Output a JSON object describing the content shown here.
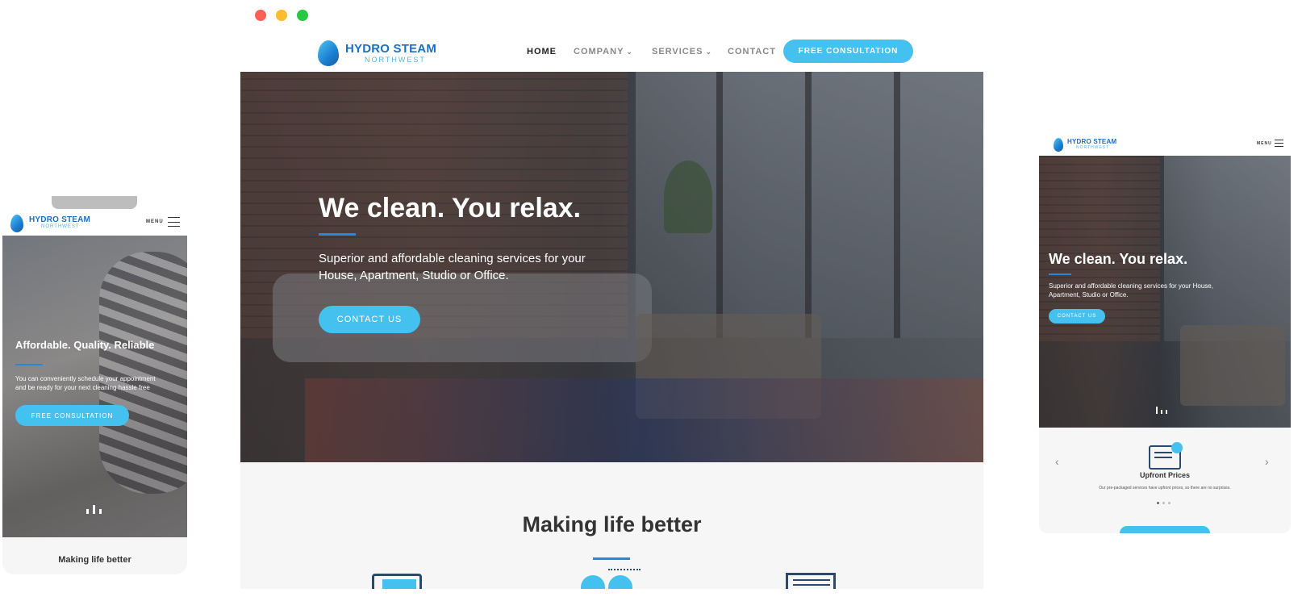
{
  "colors": {
    "brand_blue": "#1b6fc4",
    "accent_cyan": "#45c1f0",
    "underline_blue": "#2a86d6",
    "dot_red": "#ff5f57",
    "dot_yellow": "#febc2e",
    "dot_green": "#28c840"
  },
  "brand": {
    "name": "HYDRO STEAM",
    "sub": "NORTHWEST"
  },
  "desktop": {
    "nav": [
      {
        "label": "HOME",
        "active": true
      },
      {
        "label": "COMPANY",
        "dropdown": true
      },
      {
        "label": "SERVICES",
        "dropdown": true
      },
      {
        "label": "CONTACT"
      }
    ],
    "cta": "FREE CONSULTATION",
    "hero": {
      "title": "We clean. You relax.",
      "text_line1": "Superior and affordable cleaning services for your",
      "text_line2": "House, Apartment, Studio or Office.",
      "button": "CONTACT US"
    },
    "section_title": "Making life better"
  },
  "mobile_left": {
    "menu_label": "MENU",
    "hero": {
      "title": "Affordable. Quality. Reliable",
      "text_line1": "You can conveniently schedule your appointment",
      "text_line2": "and be ready for your next cleaning hassle free",
      "button": "FREE CONSULTATION"
    },
    "section_title": "Making life better"
  },
  "tablet_right": {
    "menu_label": "MENU",
    "hero": {
      "title": "We clean. You relax.",
      "text_line1": "Superior and affordable cleaning services for your House,",
      "text_line2": "Apartment, Studio or Office.",
      "button": "CONTACT US"
    },
    "feature": {
      "title": "Upfront Prices",
      "text": "Our pre-packaged services have upfront prices, so there are no surprises."
    },
    "icons": {
      "prev": "chevron-left-icon",
      "next": "chevron-right-icon",
      "feature": "price-tag-icon"
    }
  }
}
